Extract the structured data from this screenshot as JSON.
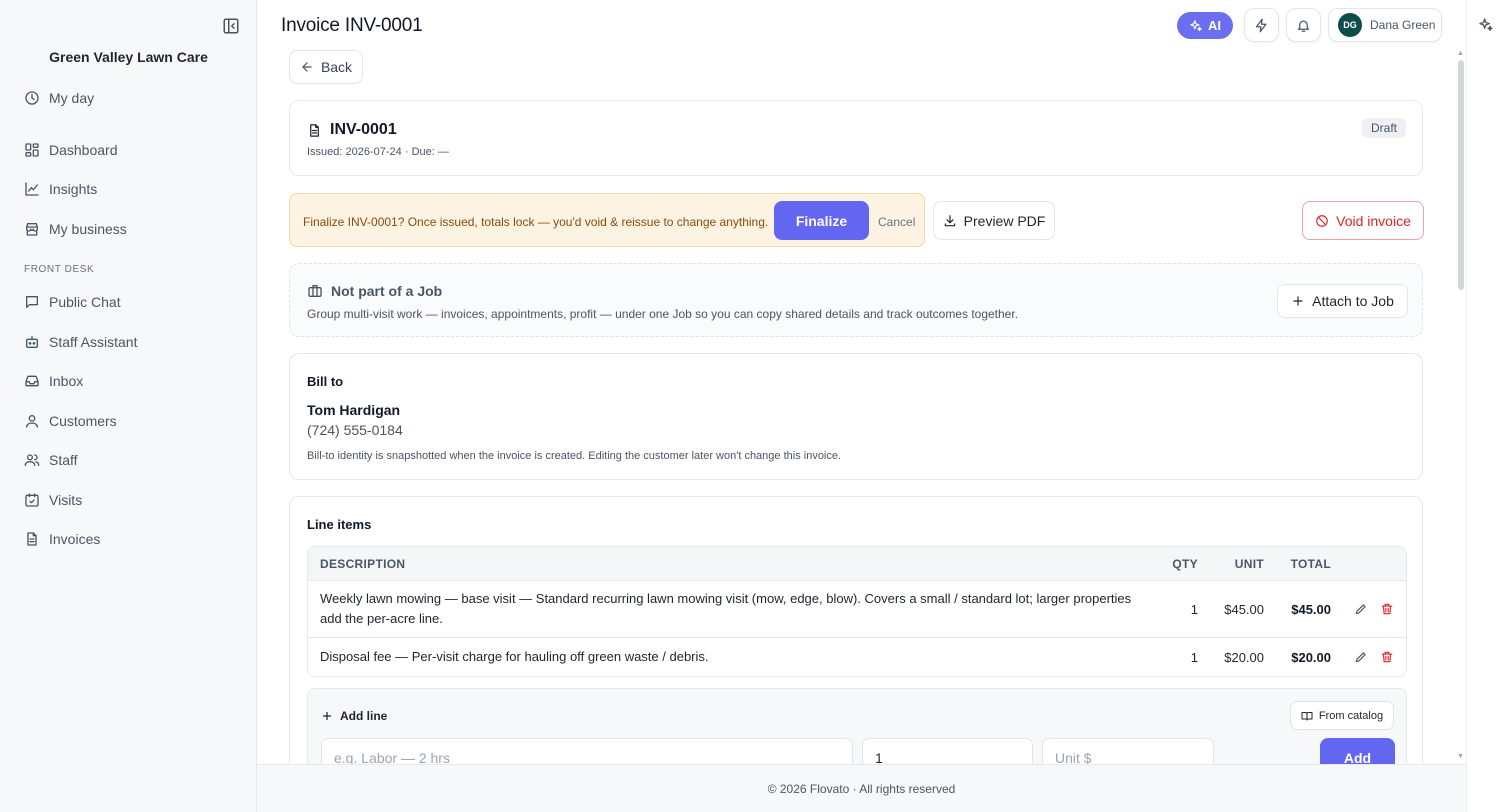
{
  "sidebar": {
    "brand": "Green Valley Lawn Care",
    "items_top": [
      {
        "label": "My day",
        "icon": "clock-icon"
      }
    ],
    "items_main": [
      {
        "label": "Dashboard",
        "icon": "dashboard-icon"
      },
      {
        "label": "Insights",
        "icon": "chart-line-icon"
      },
      {
        "label": "My business",
        "icon": "store-icon"
      }
    ],
    "section_label": "FRONT DESK",
    "items_front": [
      {
        "label": "Public Chat",
        "icon": "chat-icon"
      },
      {
        "label": "Staff Assistant",
        "icon": "bot-icon"
      },
      {
        "label": "Inbox",
        "icon": "inbox-icon"
      },
      {
        "label": "Customers",
        "icon": "user-icon"
      },
      {
        "label": "Staff",
        "icon": "users-icon"
      },
      {
        "label": "Visits",
        "icon": "calendar-check-icon"
      },
      {
        "label": "Invoices",
        "icon": "file-text-icon"
      }
    ]
  },
  "header": {
    "title": "Invoice INV-0001",
    "ai_label": "AI",
    "user_initials": "DG",
    "user_name": "Dana Green"
  },
  "back_label": "Back",
  "invoice": {
    "number": "INV-0001",
    "meta": "Issued: 2026-07-24 · Due: —",
    "status": "Draft"
  },
  "confirm": {
    "message": "Finalize INV-0001? Once issued, totals lock — you'd void & reissue to change anything.",
    "finalize_label": "Finalize",
    "cancel_label": "Cancel"
  },
  "actions": {
    "preview_label": "Preview PDF",
    "void_label": "Void invoice"
  },
  "job": {
    "title": "Not part of a Job",
    "description": "Group multi-visit work — invoices, appointments, profit — under one Job so you can copy shared details and track outcomes together.",
    "attach_label": "Attach to Job"
  },
  "bill_to": {
    "heading": "Bill to",
    "name": "Tom Hardigan",
    "phone": "(724) 555-0184",
    "note": "Bill-to identity is snapshotted when the invoice is created. Editing the customer later won't change this invoice."
  },
  "line_items": {
    "heading": "Line items",
    "columns": {
      "description": "DESCRIPTION",
      "qty": "QTY",
      "unit": "UNIT",
      "total": "TOTAL"
    },
    "rows": [
      {
        "description": "Weekly lawn mowing — base visit — Standard recurring lawn mowing visit (mow, edge, blow). Covers a small / standard lot; larger properties add the per-acre line.",
        "qty": "1",
        "unit": "$45.00",
        "total": "$45.00"
      },
      {
        "description": "Disposal fee — Per-visit charge for hauling off green waste / debris.",
        "qty": "1",
        "unit": "$20.00",
        "total": "$20.00"
      }
    ],
    "add_line_label": "Add line",
    "catalog_label": "From catalog",
    "description_placeholder": "e.g. Labor — 2 hrs",
    "qty_value": "1",
    "unit_placeholder": "Unit $",
    "add_label": "Add"
  },
  "footer": "© 2026 Flovato · All rights reserved",
  "colors": {
    "accent": "#6366f1",
    "danger": "#dc2626",
    "warning_bg": "#fdf3e3"
  }
}
